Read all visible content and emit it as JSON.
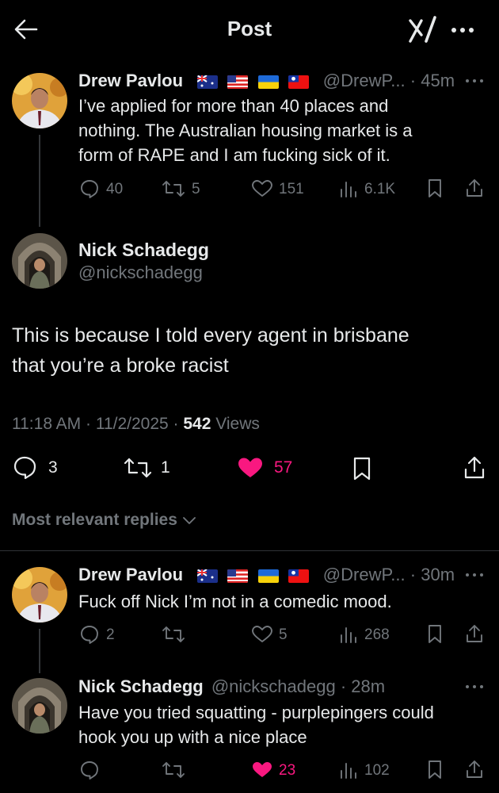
{
  "header": {
    "title": "Post"
  },
  "parent_post": {
    "author_name": "Drew Pavlou",
    "handle": "@DrewP...",
    "time": "45m",
    "text_lines": [
      "I’ve applied for more than 40 places and",
      "nothing. The Australian housing market is a",
      "form of RAPE and I am fucking sick of it."
    ],
    "replies": "40",
    "reposts": "5",
    "likes": "151",
    "views": "6.1K"
  },
  "main_post": {
    "author_name": "Nick Schadegg",
    "handle": "@nickschadegg",
    "text_lines": [
      "This is because I told every agent in brisbane",
      "that you’re a broke racist"
    ],
    "timestamp": "11:18 AM · 11/2/2025 ·",
    "views_count": "542",
    "views_label": "Views",
    "replies": "3",
    "reposts": "1",
    "likes": "57"
  },
  "replies_filter": {
    "label": "Most relevant replies"
  },
  "reply1": {
    "author_name": "Drew Pavlou",
    "handle": "@DrewP...",
    "time": "30m",
    "text": "Fuck off Nick I’m not in a comedic mood.",
    "replies": "2",
    "reposts": "",
    "likes": "5",
    "views": "268"
  },
  "reply2": {
    "author_name": "Nick Schadegg",
    "handle": "@nickschadegg",
    "time": "28m",
    "text_lines": [
      "Have you tried squatting - purplepingers could",
      "hook you up with a nice place"
    ],
    "replies": "",
    "reposts": "",
    "likes": "23",
    "views": "102"
  },
  "colors": {
    "background": "#000000",
    "text": "#e7e9ea",
    "muted": "#71767b",
    "like_pink": "#f91880"
  }
}
